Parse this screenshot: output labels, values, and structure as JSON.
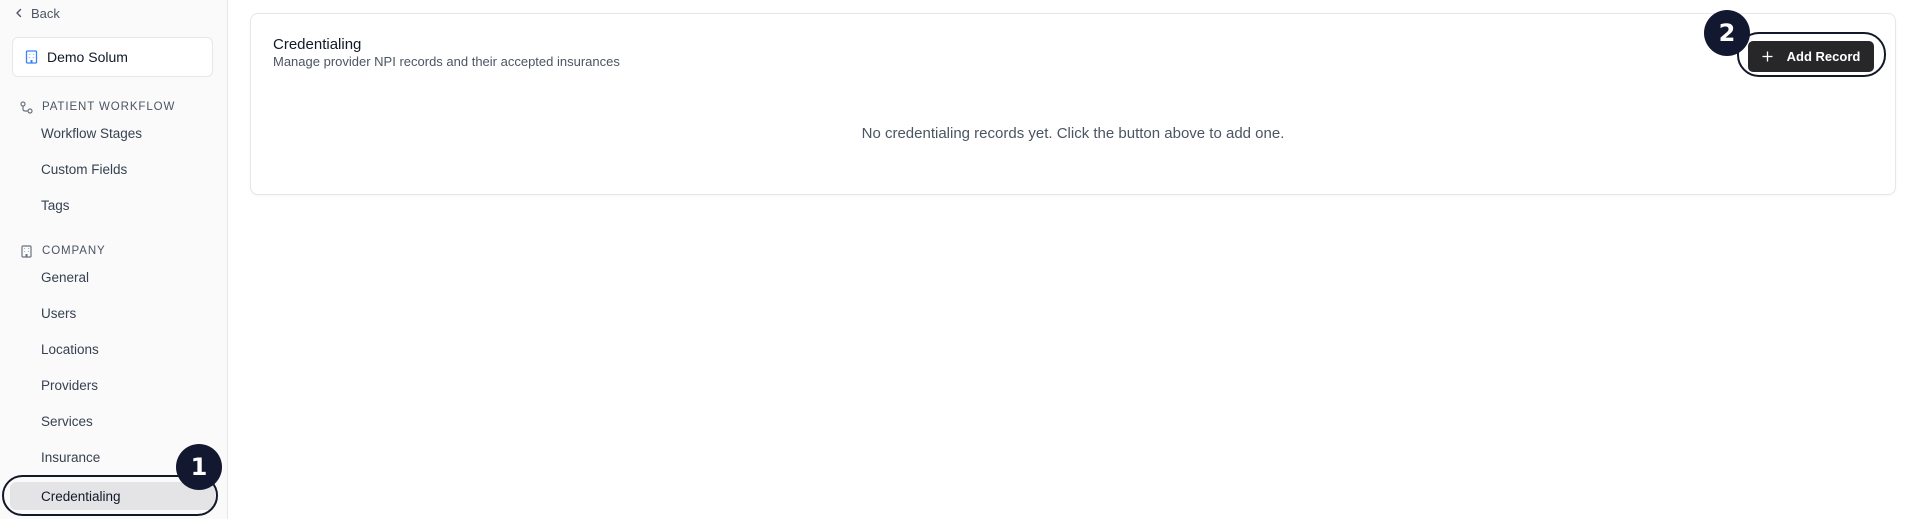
{
  "sidebar": {
    "back_label": "Back",
    "org_name": "Demo Solum",
    "sections": [
      {
        "title": "PATIENT WORKFLOW",
        "items": [
          "Workflow Stages",
          "Custom Fields",
          "Tags"
        ]
      },
      {
        "title": "COMPANY",
        "items": [
          "General",
          "Users",
          "Locations",
          "Providers",
          "Services",
          "Insurance",
          "Credentialing"
        ]
      }
    ],
    "active_item": "Credentialing"
  },
  "main": {
    "title": "Credentialing",
    "subtitle": "Manage provider NPI records and their accepted insurances",
    "empty_message": "No credentialing records yet. Click the button above to add one.",
    "add_button_label": "Add Record"
  },
  "annotations": {
    "badge_1": "1",
    "badge_2": "2"
  },
  "colors": {
    "active_item_bg": "#e4e4e7",
    "primary_button": "#27272a",
    "badge": "#111830",
    "org_icon": "#3b82f6"
  }
}
